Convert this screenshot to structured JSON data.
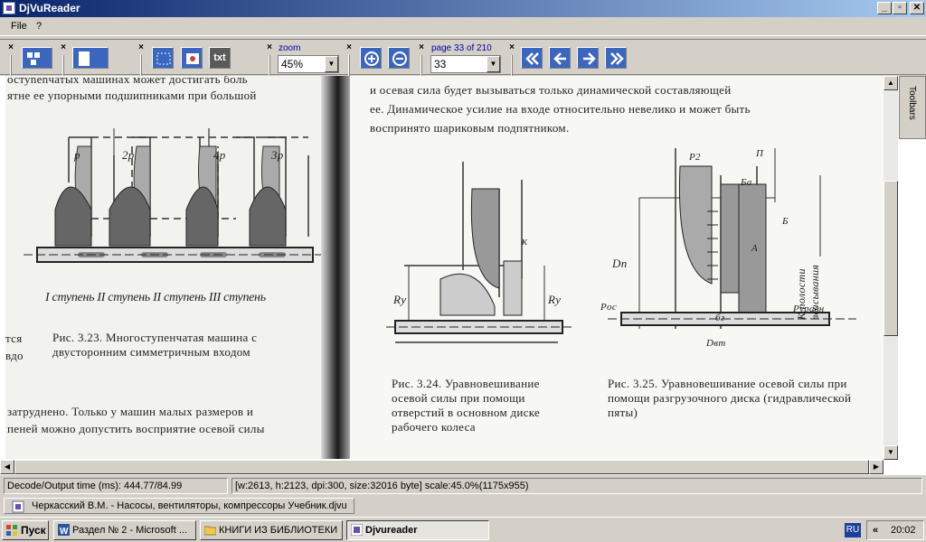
{
  "window": {
    "title": "DjVuReader",
    "minimize": "_",
    "maximize": "▫",
    "close": "✕"
  },
  "menu": {
    "file": "File",
    "help": "?"
  },
  "toolbar": {
    "zoom_label": "zoom",
    "zoom_value": "45%",
    "page_label": "page 33 of 210",
    "page_value": "33",
    "txt_button": "txt"
  },
  "document": {
    "left": {
      "line1": "остуnenчатых машинах может достигать боль",
      "line2": "ятне ее упорными подшипниками при большой",
      "labels": [
        "p",
        "2p",
        "4p",
        "3p"
      ],
      "stages": "I ступень  II ступень  II ступень  III ступень",
      "caption": "Рис. 3.23. Многоступенчатая машина с двусторонним симметричным входом",
      "side1": "тся",
      "side2": "вдо",
      "bottom1": "затруднено. Только у машин малых размеров и",
      "bottom2": "пеней можно допустить восприятие осевой силы"
    },
    "right": {
      "line1": "и осевая сила будет вызываться только динамической составляющей",
      "line2": "ее. Динамическое усилие на входе относительно невелико и может быть",
      "line3": "воспринято шариковым подпятником.",
      "caption24": "Рис. 3.24. Уравновешивание осевой силы при помощи отверстий в основном диске рабочего колеса",
      "caption25": "Рис. 3.25. Уравновешивание осевой силы при помощи разгрузочного диска (гидравлической пяты)",
      "fig24_labels": {
        "k": "к",
        "ry": "Rу"
      },
      "fig25_labels": {
        "p2": "P2",
        "n": "П",
        "ba": "Ба",
        "b": "Б",
        "a": "А",
        "dn": "Dп",
        "poc": "Pос",
        "pur": "Pуравн",
        "dt": "Dвт",
        "bg": "бг",
        "vert": "К полости всасывания"
      }
    }
  },
  "sidebar": {
    "toolbars": "Toolbars"
  },
  "status": {
    "decode": "Decode/Output time (ms): 444.77/84.99",
    "info": "[w:2613, h:2123, dpi:300, size:32016 byte] scale:45.0%(1175x955)"
  },
  "doc_tab": "Черкасский В.М. - Насосы, вентиляторы, компрессоры Учебник.djvu",
  "taskbar": {
    "start": "Пуск",
    "tasks": [
      "Раздел № 2 - Microsoft ...",
      "КНИГИ ИЗ БИБЛИОТЕКИ",
      "Djvureader"
    ],
    "lang": "RU",
    "chevron": "«",
    "clock": "20:02"
  }
}
